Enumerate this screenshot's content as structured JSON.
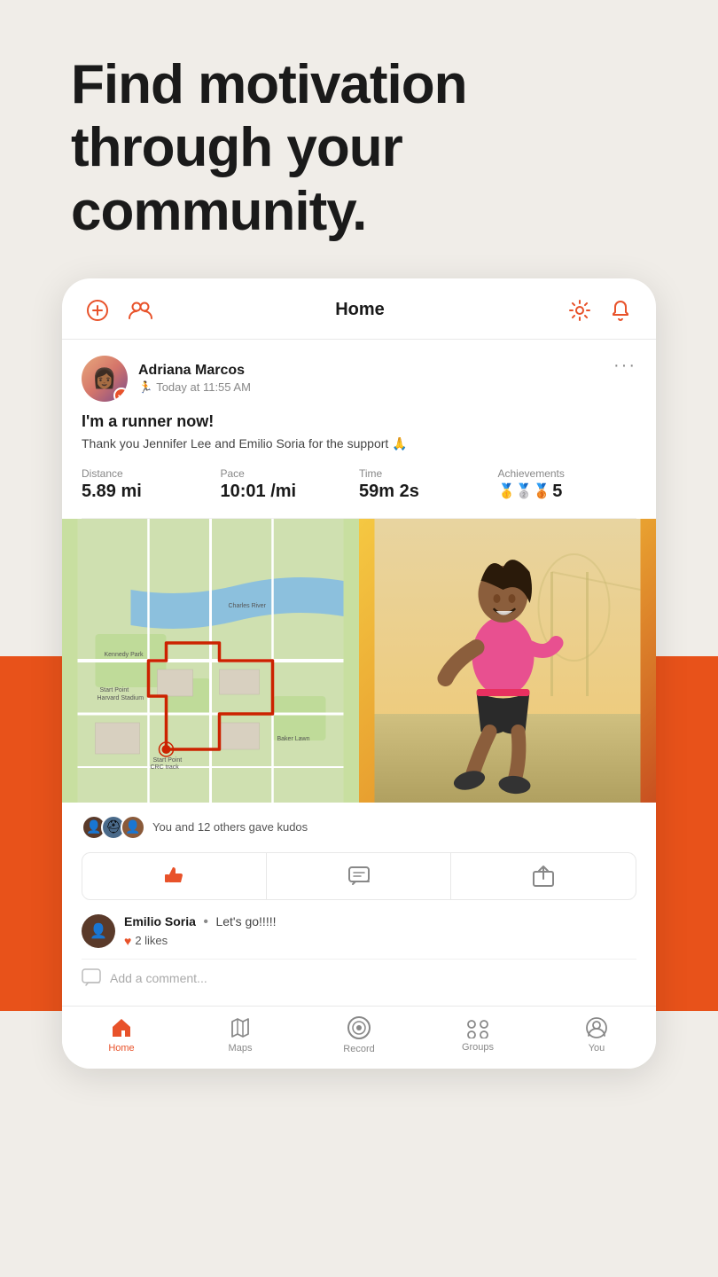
{
  "hero": {
    "title": "Find motivation through your community."
  },
  "header": {
    "title": "Home",
    "add_icon": "+",
    "friends_icon": "👥",
    "settings_icon": "⚙",
    "bell_icon": "🔔"
  },
  "post": {
    "author_name": "Adriana Marcos",
    "time": "Today at 11:55 AM",
    "title": "I'm a runner now!",
    "body": "Thank you Jennifer Lee and Emilio Soria for the support 🙏",
    "distance_label": "Distance",
    "distance_value": "5.89 mi",
    "pace_label": "Pace",
    "pace_value": "10:01 /mi",
    "time_label": "Time",
    "time_value": "59m 2s",
    "achievements_label": "Achievements",
    "achievements_value": "5",
    "achievements_icons": "🥇🥈🥉"
  },
  "social": {
    "kudos_text": "You and 12 others gave kudos",
    "comment_author": "Emilio Soria",
    "comment_separator": "•",
    "comment_text": "Let's go!!!!!",
    "comment_likes": "2 likes",
    "add_comment_placeholder": "Add a comment..."
  },
  "nav": {
    "items": [
      {
        "label": "Home",
        "active": true
      },
      {
        "label": "Maps",
        "active": false
      },
      {
        "label": "Record",
        "active": false
      },
      {
        "label": "Groups",
        "active": false
      },
      {
        "label": "You",
        "active": false
      }
    ]
  }
}
